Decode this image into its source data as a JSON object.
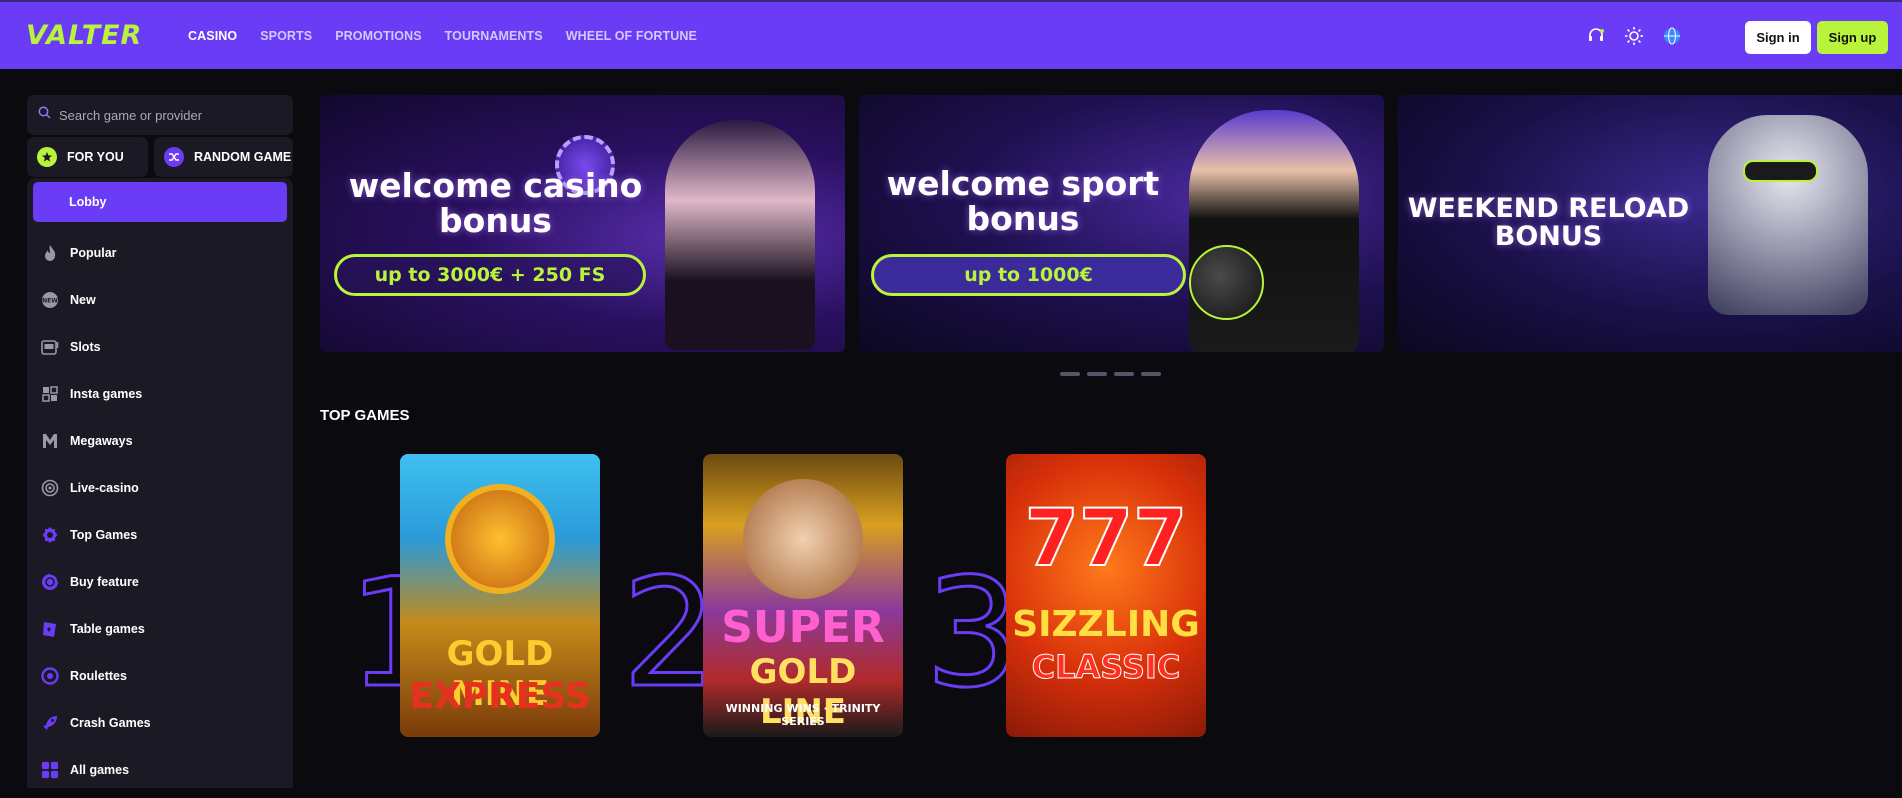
{
  "brand": {
    "logo": "VALTER",
    "accent": "#6b3cf6",
    "lime": "#b9f43a"
  },
  "nav": [
    {
      "label": "CASINO",
      "active": true
    },
    {
      "label": "SPORTS"
    },
    {
      "label": "PROMOTIONS"
    },
    {
      "label": "TOURNAMENTS"
    },
    {
      "label": "WHEEL OF FORTUNE"
    }
  ],
  "header": {
    "icons": [
      "support-icon",
      "theme-toggle-icon",
      "language-globe-icon"
    ],
    "signin_label": "Sign in",
    "signup_label": "Sign up"
  },
  "sidebar": {
    "search_placeholder": "Search game or provider",
    "quick": [
      {
        "label": "FOR YOU",
        "icon": "star-icon"
      },
      {
        "label": "RANDOM GAME",
        "icon": "shuffle-icon"
      }
    ],
    "items": [
      {
        "label": "Lobby",
        "active": true
      },
      {
        "label": "Popular",
        "icon": "flame-icon"
      },
      {
        "label": "New",
        "icon": "new-badge-icon"
      },
      {
        "label": "Slots",
        "icon": "slot-machine-icon"
      },
      {
        "label": "Insta games",
        "icon": "insta-games-icon"
      },
      {
        "label": "Megaways",
        "icon": "megaways-icon"
      },
      {
        "label": "Live-casino",
        "icon": "live-casino-icon"
      },
      {
        "label": "Top Games",
        "icon": "top-games-icon"
      },
      {
        "label": "Buy feature",
        "icon": "buy-feature-icon"
      },
      {
        "label": "Table games",
        "icon": "table-games-icon"
      },
      {
        "label": "Roulettes",
        "icon": "roulette-icon"
      },
      {
        "label": "Crash Games",
        "icon": "rocket-icon"
      },
      {
        "label": "All games",
        "icon": "grid-icon"
      }
    ]
  },
  "banners": [
    {
      "title": "welcome casino bonus",
      "offer": "up to 3000€ + 250 FS"
    },
    {
      "title": "welcome sport bonus",
      "offer": "up to 1000€"
    },
    {
      "title": "WEEKEND RELOAD BONUS",
      "offer": ""
    }
  ],
  "top_games": {
    "title": "TOP GAMES",
    "games": [
      {
        "rank": "1",
        "name_line1": "GOLD MINE",
        "name_line2": "EXPRESS"
      },
      {
        "rank": "2",
        "name_line1": "SUPER",
        "name_line2": "GOLD LINE",
        "subtitle": "WINNING WINS · TRINITY SERIES"
      },
      {
        "rank": "3",
        "name_line1": "777",
        "name_line2": "SIZZLING",
        "name_line3": "CLASSIC"
      }
    ]
  }
}
